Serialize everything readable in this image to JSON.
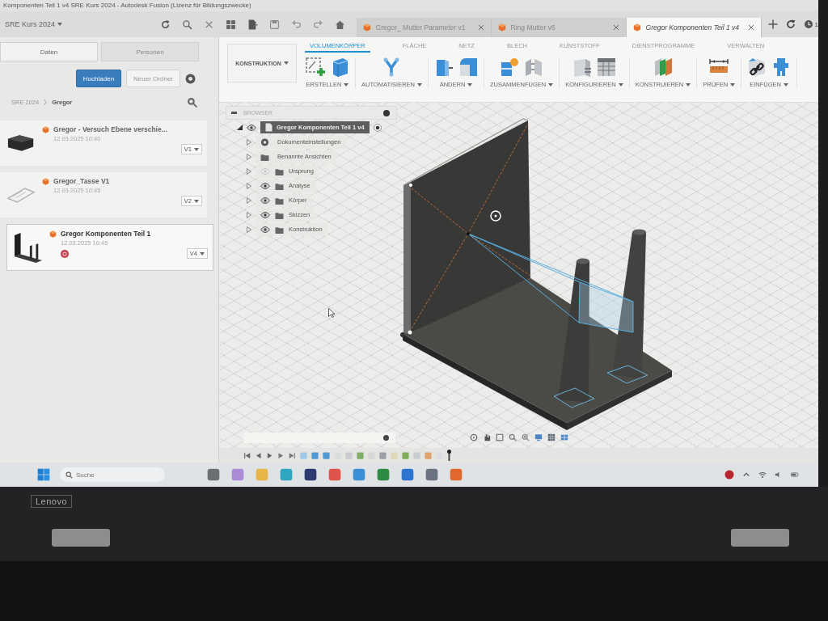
{
  "window": {
    "title": "Komponenten Teil 1 v4 SRE Kurs 2024 - Autodesk Fusion (Lizenz für Bildungszwecke)"
  },
  "app_bar": {
    "project": "SRE Kurs 2024",
    "tools": [
      {
        "kind": "refresh"
      },
      {
        "kind": "search"
      },
      {
        "kind": "close"
      },
      {
        "kind": "grid"
      },
      {
        "kind": "file"
      },
      {
        "kind": "save"
      },
      {
        "kind": "undo"
      },
      {
        "kind": "redo"
      },
      {
        "kind": "home"
      }
    ],
    "doc_tabs": [
      {
        "label": "Gregor_ Mutter Parameter v1",
        "selected": false
      },
      {
        "label": "Ring Mutter v6",
        "selected": false
      },
      {
        "label": "Gregor Komponenten Teil 1 v4",
        "selected": true
      }
    ],
    "job_count": "1"
  },
  "data_panel": {
    "tabs": [
      {
        "label": "Daten",
        "selected": true
      },
      {
        "label": "Personen",
        "selected": false
      }
    ],
    "buttons": [
      {
        "label": "Hochladen",
        "kind": "primary"
      },
      {
        "label": "Neuer Ordner",
        "kind": "secondary"
      }
    ],
    "breadcrumb": [
      "SRE 2024",
      "Gregor"
    ],
    "files": [
      {
        "name": "Gregor - Versuch Ebene verschie...",
        "date": "12.03.2025 10:40",
        "version": "V1",
        "selected": false,
        "marked": false,
        "kind": "block"
      },
      {
        "name": "Gregor_Tasse V1",
        "date": "12.03.2025 10:45",
        "version": "V2",
        "selected": false,
        "marked": false,
        "kind": "plate"
      },
      {
        "name": "Gregor Komponenten Teil 1",
        "date": "12.03.2025 10:45",
        "version": "V4",
        "selected": true,
        "marked": true,
        "kind": "bracket"
      }
    ]
  },
  "toolbar": {
    "workspace": "KONSTRUKTION",
    "tabs": [
      {
        "label": "VOLUMENKÖRPER",
        "selected": true
      },
      {
        "label": "FLÄCHE",
        "selected": false
      },
      {
        "label": "NETZ",
        "selected": false
      },
      {
        "label": "BLECH",
        "selected": false
      },
      {
        "label": "KUNSTSTOFF",
        "selected": false
      },
      {
        "label": "DIENSTPROGRAMME",
        "selected": false
      },
      {
        "label": "VERWALTEN",
        "selected": false
      }
    ],
    "groups": [
      {
        "label": "ERSTELLEN",
        "icons": [
          {
            "kind": "sketch"
          },
          {
            "kind": "box"
          }
        ]
      },
      {
        "label": "AUTOMATISIEREN",
        "icons": [
          {
            "kind": "automate"
          }
        ]
      },
      {
        "label": "ÄNDERN",
        "icons": [
          {
            "kind": "press-pull"
          },
          {
            "kind": "fillet"
          }
        ]
      },
      {
        "label": "ZUSAMMENFÜGEN",
        "icons": [
          {
            "kind": "joint"
          },
          {
            "kind": "as-built"
          }
        ]
      },
      {
        "label": "KONFIGURIEREN",
        "icons": [
          {
            "kind": "configure"
          },
          {
            "kind": "table"
          }
        ]
      },
      {
        "label": "KONSTRUIEREN",
        "icons": [
          {
            "kind": "planes"
          }
        ]
      },
      {
        "label": "PRÜFEN",
        "icons": [
          {
            "kind": "measure"
          }
        ]
      },
      {
        "label": "EINFÜGEN",
        "icons": [
          {
            "kind": "insert-link"
          },
          {
            "kind": "insert-mesh"
          }
        ]
      }
    ]
  },
  "browser": {
    "title": "BROWSER",
    "root": {
      "label": "Gregor Komponenten Teil 1 v4",
      "expanded": true,
      "visible": true,
      "children": [
        {
          "label": "Dokumenteinstellungen",
          "kind": "settings",
          "expanded": false
        },
        {
          "label": "Benannte Ansichten",
          "kind": "views",
          "expanded": false
        },
        {
          "label": "Ursprung",
          "kind": "folder",
          "visible": false,
          "expanded": false
        },
        {
          "label": "Analyse",
          "kind": "folder",
          "visible": true,
          "expanded": false
        },
        {
          "label": "Körper",
          "kind": "folder",
          "visible": true,
          "expanded": false
        },
        {
          "label": "Skizzen",
          "kind": "folder",
          "visible": true,
          "expanded": false
        },
        {
          "label": "Konstruktion",
          "kind": "folder",
          "visible": true,
          "expanded": false
        }
      ]
    }
  },
  "taskbar": {
    "placeholder": "Suche",
    "apps": [
      {
        "color": "#6b6e72"
      },
      {
        "color": "#a98bd6"
      },
      {
        "color": "#e6b649"
      },
      {
        "color": "#2ea6c0"
      },
      {
        "color": "#2b3b70"
      },
      {
        "color": "#e0544c"
      },
      {
        "color": "#3b8fd6"
      },
      {
        "color": "#2e8b44"
      },
      {
        "color": "#2d74d2"
      },
      {
        "color": "#6c7380"
      },
      {
        "color": "#e2672e"
      }
    ]
  },
  "laptop": {
    "brand": "Lenovo"
  }
}
